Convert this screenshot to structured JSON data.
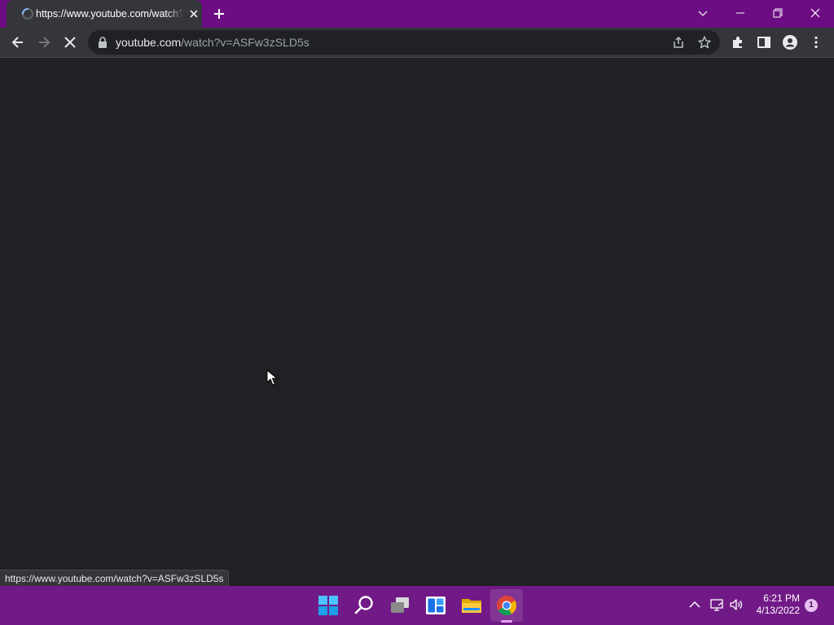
{
  "browser": {
    "tab": {
      "title": "https://www.youtube.com/watch?v=ASFw3zSLD5s",
      "loading": true
    },
    "address": {
      "host": "youtube.com",
      "path": "/watch?v=ASFw3zSLD5s"
    },
    "status_url": "https://www.youtube.com/watch?v=ASFw3zSLD5s",
    "toolbar_icons": [
      "back-icon",
      "forward-icon",
      "stop-icon",
      "lock-icon",
      "share-icon",
      "star-icon",
      "extensions-icon",
      "side-panel-icon",
      "profile-icon",
      "menu-icon"
    ],
    "window_icons": [
      "tab-search-icon",
      "minimize-icon",
      "restore-icon",
      "close-icon"
    ]
  },
  "taskbar": {
    "apps": [
      "start-icon",
      "search-icon",
      "task-view-icon",
      "widgets-icon",
      "file-explorer-icon",
      "chrome-icon"
    ],
    "active_app": "chrome-icon",
    "tray_icons": [
      "chevron-up-icon",
      "network-icon",
      "volume-icon"
    ],
    "clock": {
      "time": "6:21 PM",
      "date": "4/13/2022"
    },
    "notification_count": "1"
  },
  "colors": {
    "titlebar": "#6d0d83",
    "taskbar": "#711a87",
    "toolbar": "#35363a",
    "page_background": "#202124"
  }
}
